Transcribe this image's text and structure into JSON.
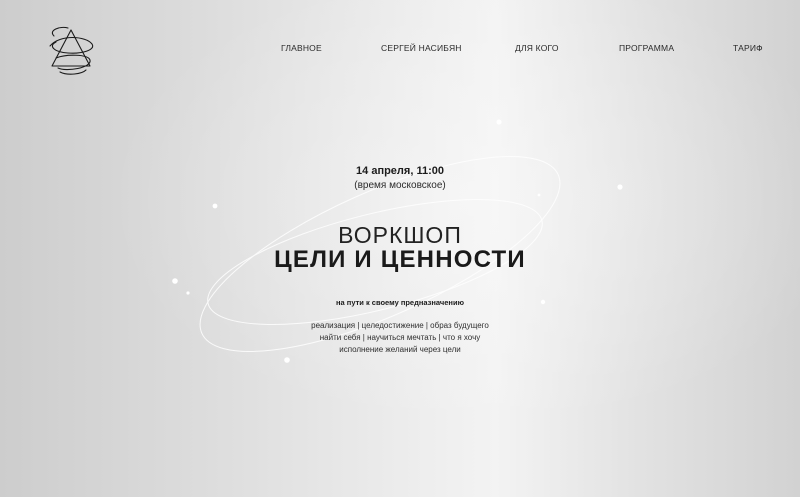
{
  "nav": {
    "items": [
      {
        "label": "ГЛАВНОЕ"
      },
      {
        "label": "СЕРГЕЙ НАСИБЯН"
      },
      {
        "label": "ДЛЯ КОГО"
      },
      {
        "label": "ПРОГРАММА"
      },
      {
        "label": "ТАРИФ"
      }
    ]
  },
  "hero": {
    "date": "14 апреля, 11:00",
    "timezone": "(время московское)",
    "title_line1": "ВОРКШОП",
    "title_line2": "ЦЕЛИ И ЦЕННОСТИ",
    "subtitle": "на пути к своему предназначению",
    "tags": [
      "реализация | целедостижение | образ будущего",
      "найти себя | научиться мечтать | что я хочу",
      "исполнение желаний через цели"
    ]
  },
  "logo": {
    "icon": "triangle-orbit-logo-icon"
  },
  "colors": {
    "text": "#1e1e1e",
    "background_left": "#cdcdcd",
    "background_center": "#f3f3f3"
  }
}
